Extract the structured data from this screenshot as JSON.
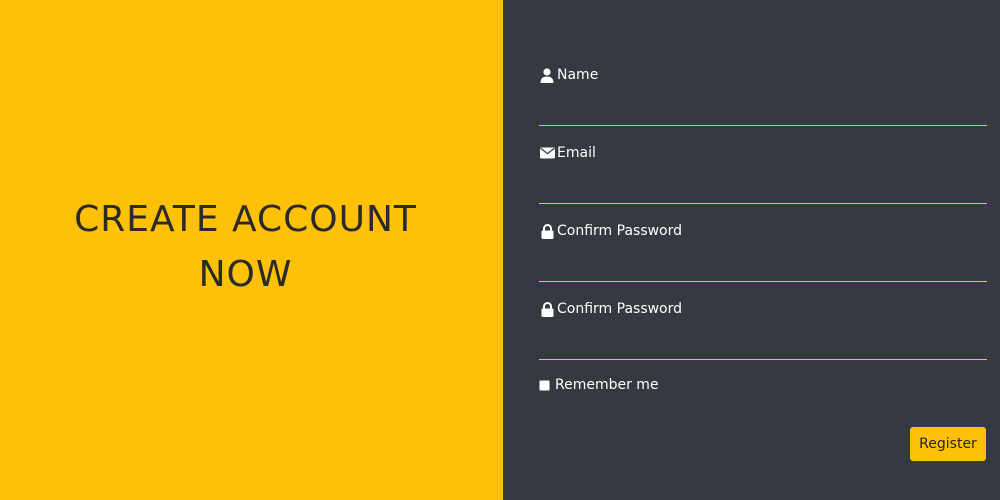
{
  "hero": {
    "title_line1": "CREATE ACCOUNT",
    "title_line2": "NOW"
  },
  "form": {
    "fields": [
      {
        "label": "Name",
        "icon": "user-icon",
        "value": ""
      },
      {
        "label": "Email",
        "icon": "envelope-icon",
        "value": ""
      },
      {
        "label": "Confirm Password",
        "icon": "lock-icon",
        "value": ""
      },
      {
        "label": "Confirm Password",
        "icon": "lock-icon",
        "value": ""
      }
    ],
    "remember_label": "Remember me",
    "remember_checked": false,
    "submit_label": "Register"
  },
  "colors": {
    "accent": "#ffc107",
    "panel_dark": "#343a40",
    "headline_text": "#2a2a2a",
    "label_text": "#ffffff"
  }
}
